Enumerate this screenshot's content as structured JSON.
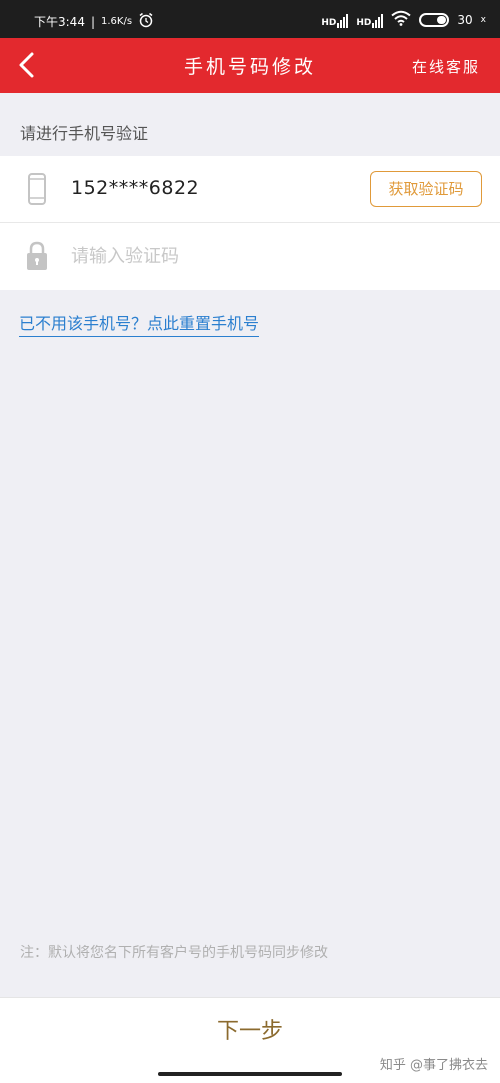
{
  "status_bar": {
    "time": "下午3:44",
    "network_speed": "1.6K/s",
    "battery_level": "30",
    "battery_suffix": "x",
    "hd_label": "HD",
    "icons": [
      "alarm-icon",
      "signal-icon",
      "wifi-icon",
      "battery-icon"
    ]
  },
  "header": {
    "title": "手机号码修改",
    "right_link": "在线客服",
    "background_color": "#E3292E"
  },
  "section_label": "请进行手机号验证",
  "form": {
    "phone_number": "152****6822",
    "get_code_button": "获取验证码",
    "code_placeholder": "请输入验证码",
    "code_value": "",
    "accent_color": "#E09A3A"
  },
  "reset_link": "已不用该手机号？点此重置手机号",
  "note": "注：默认将您名下所有客户号的手机号码同步修改",
  "bottom": {
    "next_button": "下一步",
    "watermark": "知乎 @事了拂衣去"
  }
}
